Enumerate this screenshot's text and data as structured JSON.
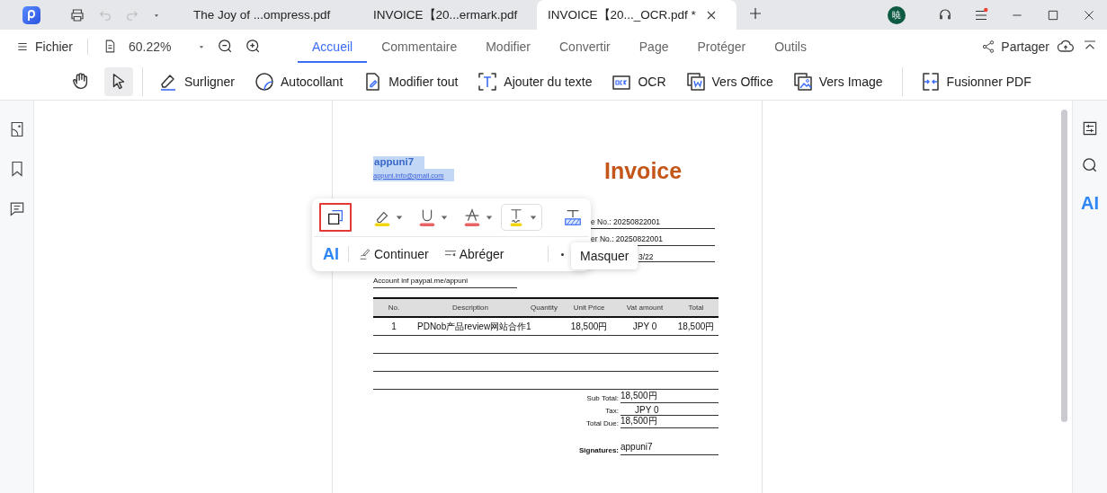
{
  "title_bar": {
    "tabs": [
      {
        "label": "The Joy of ...ompress.pdf",
        "selected": false,
        "closable": false
      },
      {
        "label": "INVOICE【20...ermark.pdf",
        "selected": false,
        "closable": false
      },
      {
        "label": "INVOICE【20..._OCR.pdf *",
        "selected": true,
        "closable": true
      }
    ],
    "avatar": "暁"
  },
  "menu_bar": {
    "file": "Fichier",
    "zoom": "60.22%",
    "tabs": [
      {
        "label": "Accueil",
        "selected": true
      },
      {
        "label": "Commentaire",
        "selected": false
      },
      {
        "label": "Modifier",
        "selected": false
      },
      {
        "label": "Convertir",
        "selected": false
      },
      {
        "label": "Page",
        "selected": false
      },
      {
        "label": "Protéger",
        "selected": false
      },
      {
        "label": "Outils",
        "selected": false
      }
    ],
    "share": "Partager"
  },
  "toolbar": {
    "modes": [
      {
        "kind": "hand",
        "selected": false
      },
      {
        "kind": "select",
        "selected": true
      }
    ],
    "tools": [
      {
        "kind": "highlight",
        "label": "Surligner"
      },
      {
        "kind": "sticker",
        "label": "Autocollant"
      },
      {
        "kind": "edit",
        "label": "Modifier tout"
      },
      {
        "kind": "text",
        "label": "Ajouter du texte"
      },
      {
        "kind": "ocr",
        "label": "OCR"
      },
      {
        "kind": "office",
        "label": "Vers Office"
      },
      {
        "kind": "image",
        "label": "Vers Image"
      },
      {
        "kind": "merge",
        "label": "Fusionner PDF"
      }
    ]
  },
  "right_sidebar": {
    "ai": "AI"
  },
  "document": {
    "sender": "appuni7",
    "email": "appuni.info@gmail.com",
    "title": "Invoice",
    "info_lines": [
      "e No.: 20250822001",
      "er No.: 20250822001",
      "3/22"
    ],
    "account": "Account inf paypal.me/appuni",
    "table": {
      "columns": [
        "No.",
        "Description",
        "Quantity",
        "Unit Price",
        "Vat amount",
        "Total"
      ],
      "rows": [
        [
          "1",
          "PDNob产品review网站合作",
          "1",
          "18,500円",
          "JPY 0",
          "18,500円"
        ]
      ]
    },
    "totals": [
      {
        "label": "Sub Total:",
        "value": "18,500円"
      },
      {
        "label": "Tax:",
        "value": "JPY 0"
      },
      {
        "label": "Total Due:",
        "value": "18,500円"
      }
    ],
    "signature": {
      "label": "Signatures:",
      "value": "appuni7"
    }
  },
  "float_toolbar": {
    "tools": [
      {
        "kind": "copy",
        "marked": true,
        "selected": false
      },
      {
        "kind": "highlight",
        "color": "#f2d50f",
        "marked": false,
        "selected": false
      },
      {
        "kind": "underline",
        "color": "#e86464",
        "marked": false,
        "selected": false
      },
      {
        "kind": "strike",
        "color": "#e86464",
        "marked": false,
        "selected": false
      },
      {
        "kind": "squiggly",
        "color": "#f2d50f",
        "marked": false,
        "selected": true
      },
      {
        "kind": "area",
        "marked": false,
        "selected": false
      }
    ],
    "ai": "AI",
    "actions": [
      {
        "kind": "continue",
        "label": "Continuer"
      },
      {
        "kind": "shorten",
        "label": "Abréger"
      }
    ],
    "tooltip": "Masquer"
  }
}
